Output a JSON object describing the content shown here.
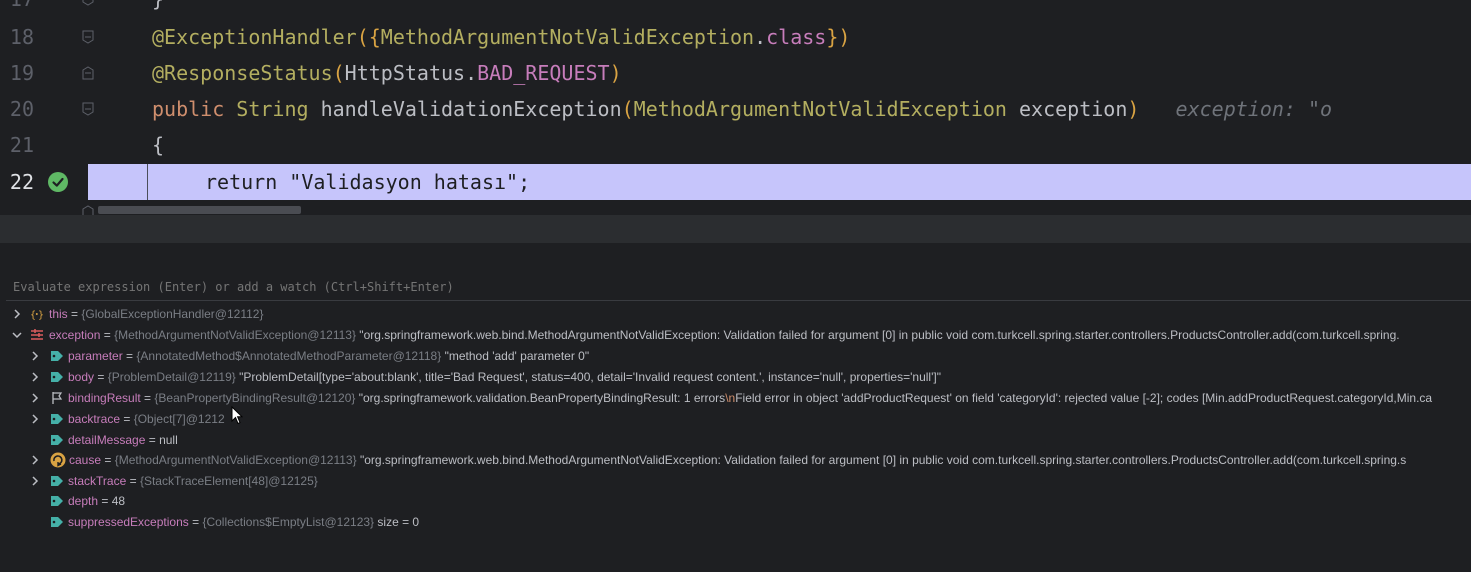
{
  "editor": {
    "lines": [
      {
        "num": "17",
        "code": "}"
      },
      {
        "num": "18",
        "annotation": "@ExceptionHandler",
        "open": "({",
        "cls": "MethodArgumentNotValidException",
        "dot": ".",
        "kw": "class",
        "close": "})"
      },
      {
        "num": "19",
        "annotation": "@ResponseStatus",
        "open": "(",
        "cls": "HttpStatus",
        "dot": ".",
        "field": "BAD_REQUEST",
        "close": ")"
      },
      {
        "num": "20",
        "kw": "public",
        "type": "String",
        "method": "handleValidationException",
        "open": "(",
        "param_type": "MethodArgumentNotValidException",
        "param": "exception",
        "close": ")",
        "hint": "exception: \"o"
      },
      {
        "num": "21",
        "code": "{"
      },
      {
        "num": "22",
        "code": "return \"Validasyon hatası\";"
      }
    ]
  },
  "debugger": {
    "eval_placeholder": "Evaluate expression (Enter) or add a watch (Ctrl+Shift+Enter)",
    "variables": [
      {
        "name": "this",
        "eq": " = ",
        "type": "{GlobalExceptionHandler@12112}",
        "value": ""
      },
      {
        "name": "exception",
        "eq": " = ",
        "type": "{MethodArgumentNotValidException@12113}",
        "value": " \"org.springframework.web.bind.MethodArgumentNotValidException: Validation failed for argument [0] in public void com.turkcell.spring.starter.controllers.ProductsController.add(com.turkcell.spring."
      },
      {
        "name": "parameter",
        "eq": " = ",
        "type": "{AnnotatedMethod$AnnotatedMethodParameter@12118}",
        "value": " \"method 'add' parameter 0\""
      },
      {
        "name": "body",
        "eq": " = ",
        "type": "{ProblemDetail@12119}",
        "value": " \"ProblemDetail[type='about:blank', title='Bad Request', status=400, detail='Invalid request content.', instance='null', properties='null']\""
      },
      {
        "name": "bindingResult",
        "eq": " = ",
        "type": "{BeanPropertyBindingResult@12120}",
        "value_a": " \"org.springframework.validation.BeanPropertyBindingResult: 1 errors",
        "value_nl": "\\n",
        "value_b": "Field error in object 'addProductRequest' on field 'categoryId': rejected value [-2]; codes [Min.addProductRequest.categoryId,Min.ca"
      },
      {
        "name": "backtrace",
        "eq": " = ",
        "type": "{Object[7]@1212",
        "value": ""
      },
      {
        "name": "detailMessage",
        "eq": " = ",
        "type": "",
        "value": "null"
      },
      {
        "name": "cause",
        "eq": " = ",
        "type": "{MethodArgumentNotValidException@12113}",
        "value": " \"org.springframework.web.bind.MethodArgumentNotValidException: Validation failed for argument [0] in public void com.turkcell.spring.starter.controllers.ProductsController.add(com.turkcell.spring.s"
      },
      {
        "name": "stackTrace",
        "eq": " = ",
        "type": "{StackTraceElement[48]@12125}",
        "value": ""
      },
      {
        "name": "depth",
        "eq": " = ",
        "type": "",
        "value": "48"
      },
      {
        "name": "suppressedExceptions",
        "eq": " = ",
        "type": "{Collections$EmptyList@12123}",
        "value": "  size = 0"
      }
    ]
  },
  "icons": {
    "breakpoint": "breakpoint-check-icon",
    "fold": "fold-marker-icon",
    "field": "field-tag-icon",
    "object": "object-braces-icon",
    "exception": "exception-icon",
    "recursive": "recursive-cause-icon",
    "flag": "flag-icon"
  },
  "colors": {
    "highlight_line": "#c6c5fb",
    "breakpoint": "#5fb865",
    "field_icon": "#45b0a8"
  }
}
